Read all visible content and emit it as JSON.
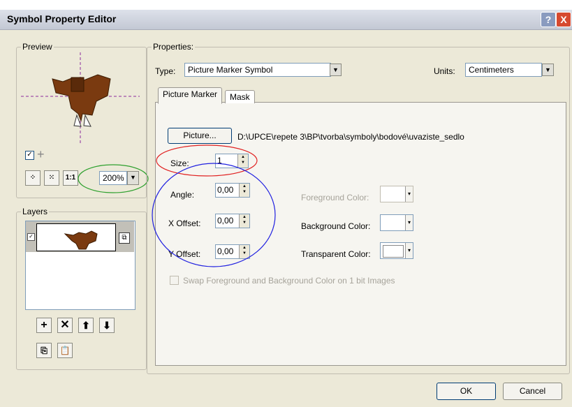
{
  "window": {
    "title": "Symbol Property Editor",
    "help": "?",
    "close": "X"
  },
  "preview": {
    "legend": "Preview",
    "zoom": "200%"
  },
  "layers": {
    "legend": "Layers"
  },
  "properties": {
    "legend": "Properties:",
    "type_label": "Type:",
    "type_value": "Picture Marker Symbol",
    "units_label": "Units:",
    "units_value": "Centimeters",
    "tabs": [
      {
        "label": "Picture Marker"
      },
      {
        "label": "Mask"
      }
    ],
    "picture_button": "Picture...",
    "picture_path": "D:\\UPCE\\repete 3\\BP\\tvorba\\symboly\\bodové\\uvaziste_sedlo",
    "size_label": "Size:",
    "size_value": "1",
    "angle_label": "Angle:",
    "angle_value": "0,00",
    "xoffset_label": "X Offset:",
    "xoffset_value": "0,00",
    "yoffset_label": "Y Offset:",
    "yoffset_value": "0,00",
    "foreground_label": "Foreground Color:",
    "background_label": "Background Color:",
    "transparent_label": "Transparent Color:",
    "swap_label": "Swap Foreground and Background Color on 1 bit Images"
  },
  "footer": {
    "ok": "OK",
    "cancel": "Cancel"
  },
  "colors": {
    "annotation_red": "#e02020",
    "annotation_green": "#2ea02e",
    "annotation_blue": "#2020e0",
    "marker_brown": "#7a3a10"
  }
}
